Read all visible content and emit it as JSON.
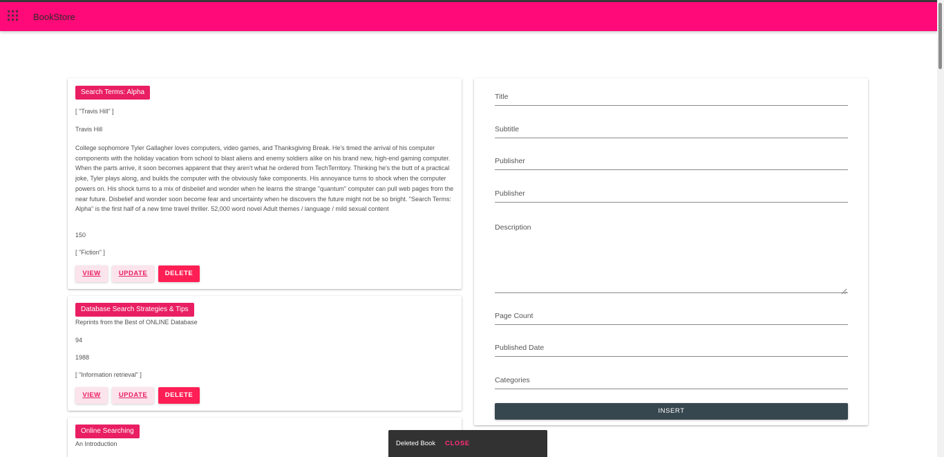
{
  "app": {
    "title": "BookStore",
    "menu_icon": "apps-grid-icon"
  },
  "books": [
    {
      "title": "Search Terms: Alpha",
      "lines": [
        "[ \"Travis Hill\" ]",
        "Travis Hill"
      ],
      "description": "College sophomore Tyler Gallagher loves computers, video games, and Thanksgiving Break. He's timed the arrival of his computer components with the holiday vacation from school to blast aliens and enemy soldiers alike on his brand new, high-end gaming computer. When the parts arrive, it soon becomes apparent that they aren't what he ordered from TechTerritory. Thinking he's the butt of a practical joke, Tyler plays along, and builds the computer with the obviously fake components. His annoyance turns to shock when the computer powers on. His shock turns to a mix of disbelief and wonder when he learns the strange \"quantum\" computer can pull web pages from the near future. Disbelief and wonder soon become fear and uncertainty when he discovers the future might not be so bright. \"Search Terms: Alpha\" is the first half of a new time travel thriller. 52,000 word novel Adult themes / language / mild sexual content",
      "page_count": "150",
      "categories": "[ \"Fiction\" ]"
    },
    {
      "title": "Database Search Strategies & Tips",
      "subtitle": "Reprints from the Best of ONLINE Database",
      "page_count": "94",
      "published_date": "1988",
      "categories": "[ \"Information retrieval\" ]"
    },
    {
      "title": "Online Searching",
      "subtitle": "An Introduction"
    }
  ],
  "actions": {
    "view": "VIEW",
    "update": "UPDATE",
    "delete": "DELETE"
  },
  "form": {
    "title": "Title",
    "subtitle": "Subtitle",
    "publisher": "Publisher",
    "publisher2": "Publisher",
    "description": "Description",
    "page_count": "Page Count",
    "published_date": "Published Date",
    "categories": "Categories",
    "submit": "INSERT"
  },
  "snackbar": {
    "message": "Deleted Book",
    "action": "CLOSE"
  }
}
